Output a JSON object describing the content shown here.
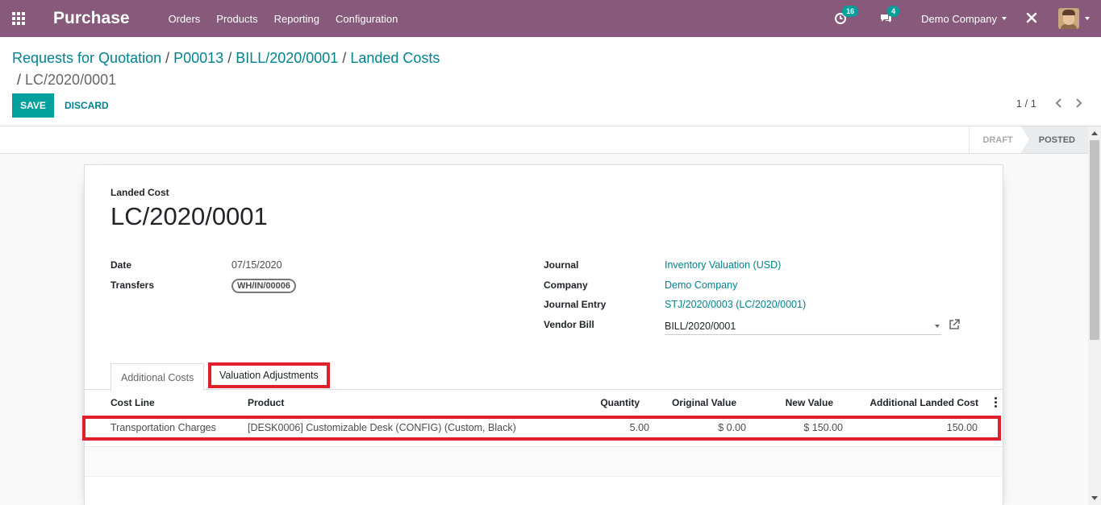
{
  "navbar": {
    "app_title": "Purchase",
    "menu": [
      "Orders",
      "Products",
      "Reporting",
      "Configuration"
    ],
    "activities_count": "16",
    "messages_count": "4",
    "company": "Demo Company",
    "bg_color": "#875a7b"
  },
  "breadcrumb": {
    "items": [
      "Requests for Quotation",
      "P00013",
      "BILL/2020/0001",
      "Landed Costs"
    ],
    "current": "LC/2020/0001"
  },
  "actions": {
    "save_label": "SAVE",
    "discard_label": "DISCARD"
  },
  "pager": {
    "value": "1 / 1"
  },
  "status": {
    "stages": [
      "DRAFT",
      "POSTED"
    ],
    "current": "POSTED"
  },
  "form": {
    "label": "Landed Cost",
    "title": "LC/2020/0001",
    "date_label": "Date",
    "date_value": "07/15/2020",
    "transfers_label": "Transfers",
    "transfers_tag": "WH/IN/00006",
    "journal_label": "Journal",
    "journal_value": "Inventory Valuation (USD)",
    "company_label": "Company",
    "company_value": "Demo Company",
    "journal_entry_label": "Journal Entry",
    "journal_entry_value": "STJ/2020/0003 (LC/2020/0001)",
    "vendor_bill_label": "Vendor Bill",
    "vendor_bill_value": "BILL/2020/0001"
  },
  "tabs": [
    "Additional Costs",
    "Valuation Adjustments"
  ],
  "table": {
    "columns": [
      "Cost Line",
      "Product",
      "Quantity",
      "Original Value",
      "New Value",
      "Additional Landed Cost"
    ],
    "rows": [
      {
        "cost_line": "Transportation Charges",
        "product": "[DESK0006] Customizable Desk (CONFIG) (Custom, Black)",
        "quantity": "5.00",
        "original_value": "$ 0.00",
        "new_value": "$ 150.00",
        "additional_landed_cost": "150.00"
      }
    ]
  },
  "colors": {
    "accent": "#00a09d",
    "link": "#00838f",
    "highlight": "#e01f2a"
  },
  "icons": [
    "apps-grid-icon",
    "activity-clock-icon",
    "chat-bubble-icon",
    "debug-tools-icon",
    "avatar",
    "chevron-left-icon",
    "chevron-right-icon",
    "external-link-icon",
    "column-menu-icon"
  ]
}
